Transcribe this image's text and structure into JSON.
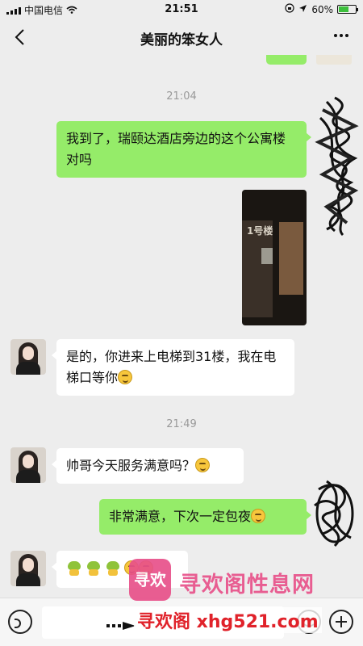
{
  "status_bar": {
    "carrier": "中国电信",
    "time": "21:51",
    "battery": "60%",
    "battery_level": 0.6
  },
  "header": {
    "title": "美丽的笨女人"
  },
  "messages": [
    {
      "type": "time",
      "text": "21:04"
    },
    {
      "type": "text",
      "side": "right",
      "text": "我到了，瑞颐达酒店旁边的这个公寓楼对吗"
    },
    {
      "type": "image",
      "side": "right",
      "image_text": "1号楼"
    },
    {
      "type": "text",
      "side": "left",
      "text": "是的，你进来上电梯到31楼，我在电梯口等你",
      "emoji": "smile"
    },
    {
      "type": "time",
      "text": "21:49"
    },
    {
      "type": "text",
      "side": "left",
      "text": "帅哥今天服务满意吗？",
      "emoji": "sleepy"
    },
    {
      "type": "text",
      "side": "right",
      "text": "非常满意，下次一定包夜",
      "emoji": "kiss"
    },
    {
      "type": "emoji",
      "side": "left",
      "emoji": "frog-thumbs"
    }
  ],
  "watermark": {
    "logo": "寻欢",
    "title": "寻欢阁性息网",
    "url": "寻欢阁 xhg521.com"
  },
  "icons": {
    "back": "chevron-left-icon",
    "more": "more-icon",
    "voice": "voice-icon",
    "emoji": "emoji-icon",
    "plus": "plus-icon"
  }
}
